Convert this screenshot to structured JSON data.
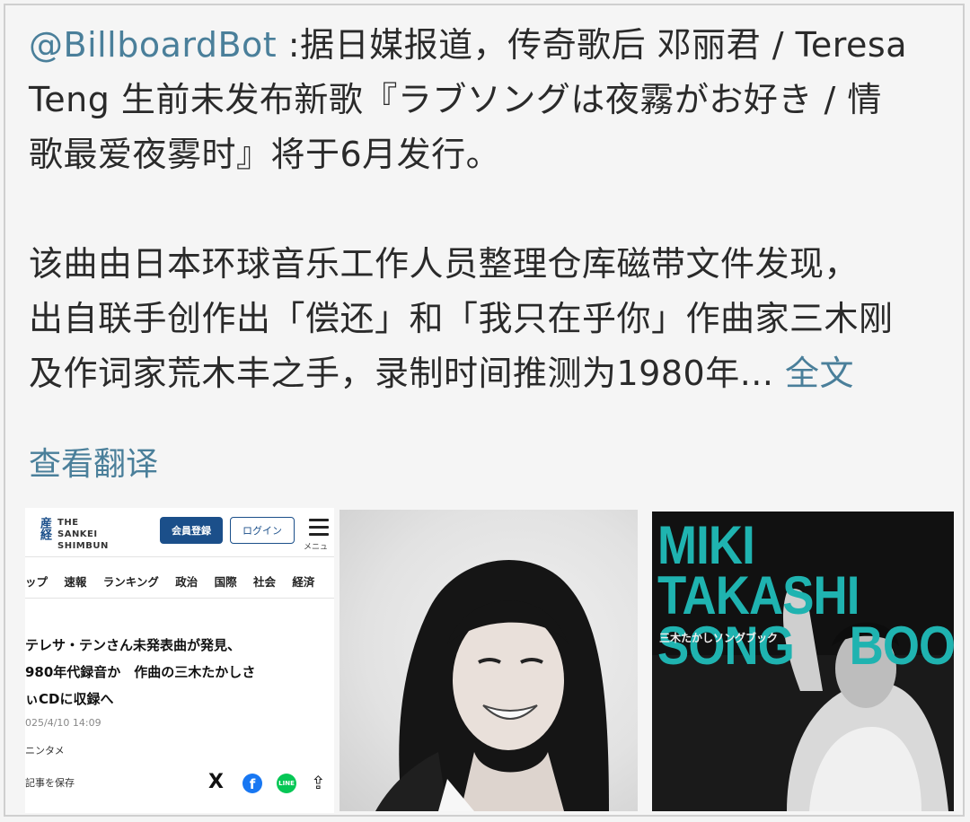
{
  "post": {
    "handle": "@BillboardBot",
    "line1_body": " :据日媒报道，传奇歌后 邓丽君 / Teresa",
    "line2": "Teng 生前未发布新歌『ラブソングは夜霧がお好き / 情",
    "line3": "歌最爱夜雾时』将于6月发行。",
    "para2_line1": "该曲由日本环球音乐工作人员整理仓库磁带文件发现，",
    "para2_line2": "出自联手创作出「偿还」和「我只在乎你」作曲家三木刚",
    "para2_line3": "及作词家荒木丰之手，录制时间推测为1980年...",
    "more_label": "全文",
    "translate_label": "查看翻译"
  },
  "news": {
    "logo_kanji": "産経",
    "logo_line1": "THE",
    "logo_line2": "SANKEI",
    "logo_line3": "SHIMBUN",
    "register_label": "会員登録",
    "login_label": "ログイン",
    "menu_label": "メニュ",
    "nav": [
      "ップ",
      "速報",
      "ランキング",
      "政治",
      "国際",
      "社会",
      "経済"
    ],
    "headline_line1": "テレサ・テンさん未発表曲が発見、",
    "headline_line2": "980年代録音か　作曲の三木たかしさ",
    "headline_line3": "ぃCDに収録へ",
    "date": "025/4/10 14:09",
    "category": "ニンタメ",
    "save_label": "記事を保存",
    "share_x": "X",
    "share_fb": "f",
    "share_line": "LINE",
    "share_export": "⇪"
  },
  "album": {
    "title_line1": "MIKI TAKASHI",
    "title_line2_a": "SONG",
    "title_line2_b": "BOOK",
    "subtitle": "三木たかしソングブック",
    "title_color": "#1fb3b0"
  },
  "colors": {
    "link": "#4a7f9a",
    "text": "#2a2a2a",
    "sankei_blue": "#1b4f8a"
  }
}
